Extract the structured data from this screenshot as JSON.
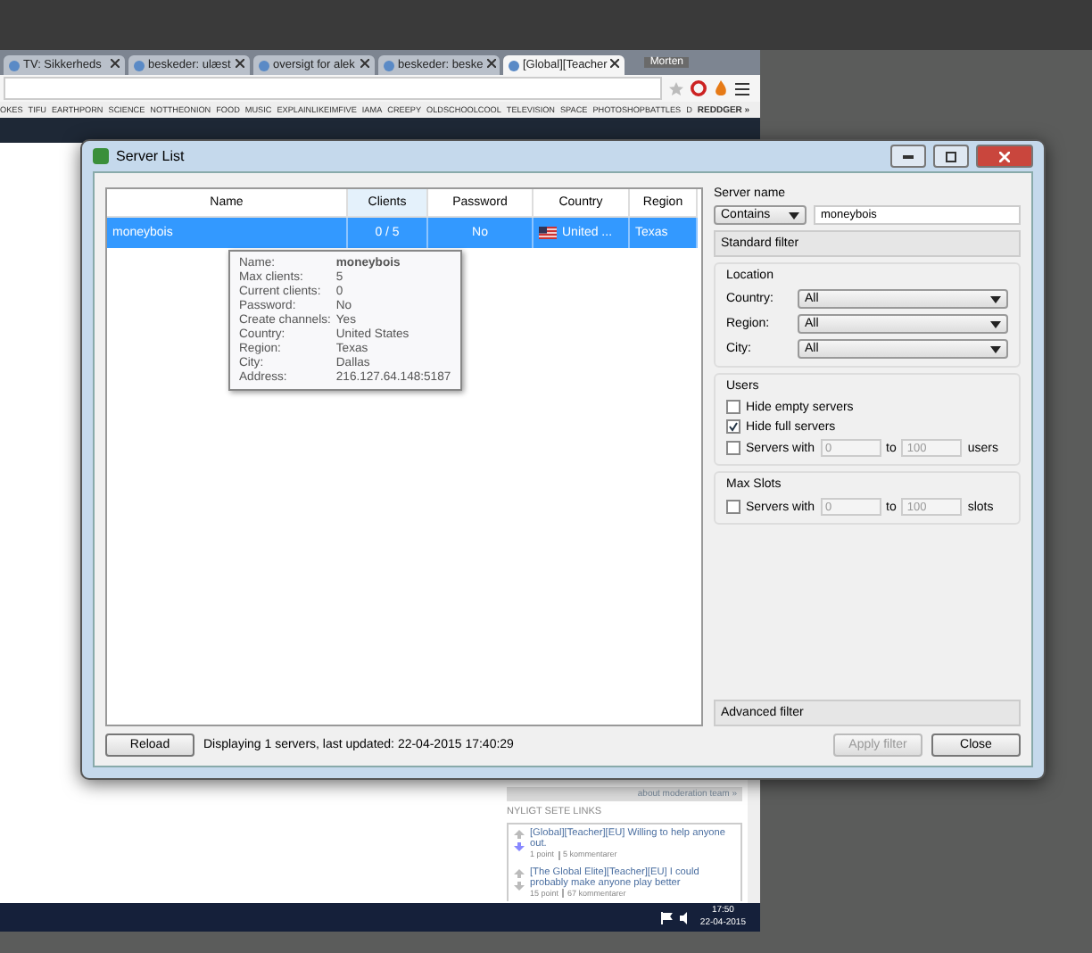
{
  "browser": {
    "tabs": [
      {
        "title": "TV: Sikkerheds",
        "selected": false
      },
      {
        "title": "beskeder: ulæst",
        "selected": false
      },
      {
        "title": "oversigt for alek",
        "selected": false
      },
      {
        "title": "beskeder: beske",
        "selected": false
      },
      {
        "title": "[Global][Teacher",
        "selected": true
      }
    ],
    "user_name": "Morten",
    "bookmarks": [
      "OKES",
      "TIFU",
      "EARTHPORN",
      "SCIENCE",
      "NOTTHEONION",
      "FOOD",
      "MUSIC",
      "EXPLAINLIKEIMFIVE",
      "IAMA",
      "CREEPY",
      "OLDSCHOOLCOOL",
      "TELEVISION",
      "SPACE",
      "PHOTOSHOPBATTLES",
      "D"
    ],
    "bookmark_more": "REDDGER »",
    "sidebar": {
      "moderation_link": "about moderation team »",
      "heading": "NYLIGT SETE LINKS",
      "links": [
        {
          "title": "[Global][Teacher][EU] Willing to help anyone out.",
          "points": "1 point",
          "comments": "5 kommentarer",
          "upvoted": false,
          "downvoted": true
        },
        {
          "title": "[The Global Elite][Teacher][EU] I could probably make anyone play better",
          "points": "15 point",
          "comments": "67 kommentarer",
          "upvoted": false,
          "downvoted": false
        }
      ]
    }
  },
  "dialog": {
    "title": "Server List",
    "columns": [
      {
        "label": "Name",
        "sorted": false
      },
      {
        "label": "Clients",
        "sorted": true
      },
      {
        "label": "Password",
        "sorted": false
      },
      {
        "label": "Country",
        "sorted": false
      },
      {
        "label": "Region",
        "sorted": false
      }
    ],
    "rows": [
      {
        "name": "moneybois",
        "clients": "0 / 5",
        "password": "No",
        "country": "United ...",
        "region": "Texas",
        "selected": true
      }
    ],
    "tooltip": [
      {
        "label": "Name:",
        "value": "moneybois"
      },
      {
        "label": "Max clients:",
        "value": "5"
      },
      {
        "label": "Current clients:",
        "value": "0"
      },
      {
        "label": "Password:",
        "value": "No"
      },
      {
        "label": "Create channels:",
        "value": "Yes"
      },
      {
        "label": "Country:",
        "value": "United States"
      },
      {
        "label": "Region:",
        "value": "Texas"
      },
      {
        "label": "City:",
        "value": "Dallas"
      },
      {
        "label": "Address:",
        "value": "216.127.64.148:5187"
      }
    ],
    "filter": {
      "server_name_label": "Server name",
      "match_mode": "Contains",
      "server_name": "moneybois",
      "standard_filter": "Standard filter",
      "location": {
        "title": "Location",
        "fields": [
          {
            "label": "Country:",
            "value": "All"
          },
          {
            "label": "Region:",
            "value": "All"
          },
          {
            "label": "City:",
            "value": "All"
          }
        ]
      },
      "users": {
        "title": "Users",
        "hide_empty": {
          "label": "Hide empty servers",
          "checked": false
        },
        "hide_full": {
          "label": "Hide full servers",
          "checked": true
        },
        "range": {
          "checked": false,
          "label": "Servers with",
          "from": "0",
          "to_label": "to",
          "to": "100",
          "unit": "users"
        }
      },
      "max_slots": {
        "title": "Max Slots",
        "range": {
          "checked": false,
          "label": "Servers with",
          "from": "0",
          "to_label": "to",
          "to": "100",
          "unit": "slots"
        }
      },
      "advanced_filter": "Advanced filter"
    },
    "reload": "Reload",
    "status": "Displaying 1 servers, last updated: 22-04-2015 17:40:29",
    "apply": {
      "label": "Apply filter",
      "disabled": true
    },
    "close": "Close"
  },
  "taskbar": {
    "time": "17:50",
    "date": "22-04-2015"
  }
}
